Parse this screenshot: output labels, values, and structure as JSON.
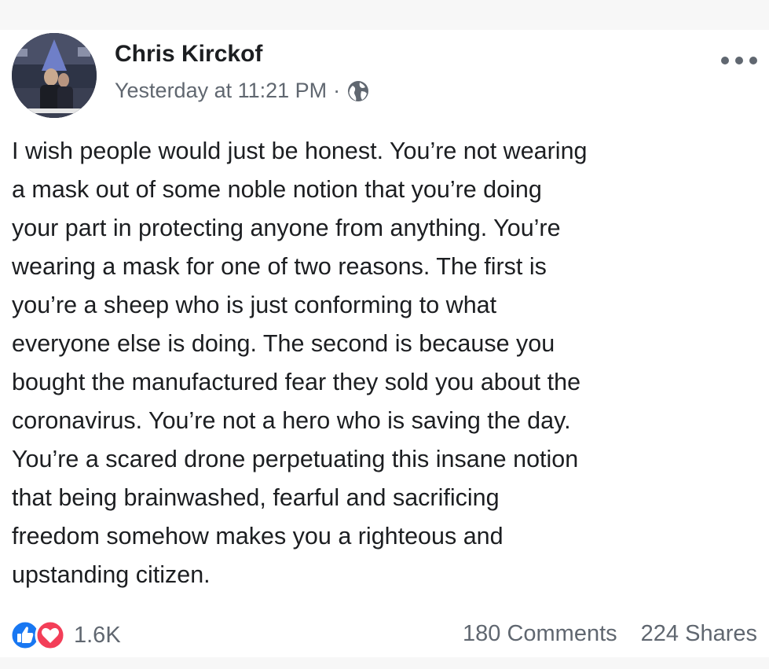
{
  "post": {
    "author": "Chris Kirckof",
    "timestamp": "Yesterday at 11:21 PM",
    "separator": "·",
    "privacy_icon": "globe-icon",
    "more_icon": "more-options-icon",
    "text_lines": [
      "I wish people would just be honest. You’re not wearing",
      "a mask out of some noble notion that you’re doing",
      "your part in protecting anyone from anything. You’re",
      "wearing a mask for one of two reasons. The first is",
      "you’re a sheep who is just conforming to what",
      "everyone else is doing. The second is because you",
      "bought the manufactured fear they sold you about the",
      "coronavirus. You’re not a hero who is saving the day.",
      "You’re a scared drone perpetuating this insane notion",
      "that being brainwashed, fearful and sacrificing",
      "freedom somehow makes you a righteous and",
      "upstanding citizen."
    ]
  },
  "footer": {
    "reaction_icons": [
      "like-icon",
      "love-icon"
    ],
    "reaction_count": "1.6K",
    "comments": "180 Comments",
    "shares": "224 Shares"
  },
  "colors": {
    "text_primary": "#1c1e21",
    "text_secondary": "#606770",
    "like_blue": "#1877f2",
    "love_red": "#f33e58"
  }
}
